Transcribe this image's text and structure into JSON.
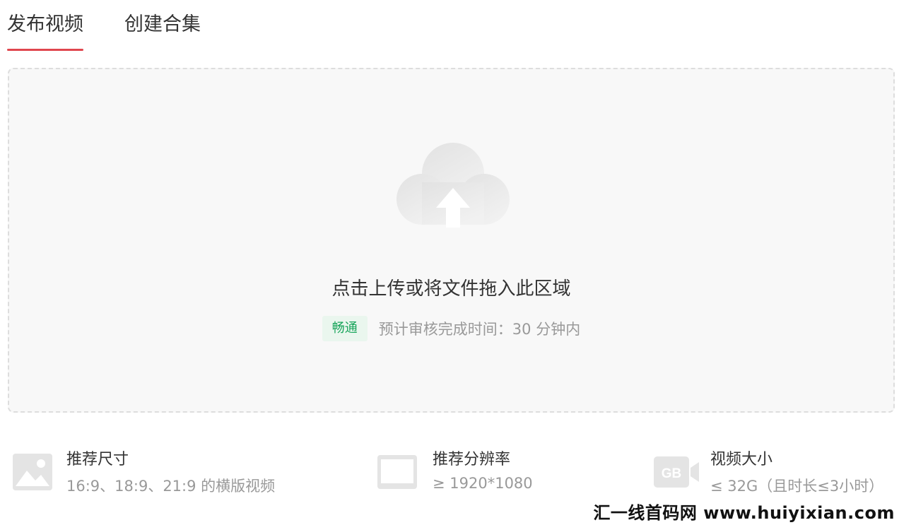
{
  "tabs": [
    {
      "label": "发布视频",
      "active": true
    },
    {
      "label": "创建合集",
      "active": false
    }
  ],
  "upload": {
    "icon": "cloud-upload-icon",
    "prompt": "点击上传或将文件拖入此区域",
    "status_badge": "畅通",
    "eta_text": "预计审核完成时间：30 分钟内"
  },
  "specs": [
    {
      "icon": "image-icon",
      "title": "推荐尺寸",
      "value": "16:9、18:9、21:9 的横版视频"
    },
    {
      "icon": "monitor-icon",
      "title": "推荐分辨率",
      "value": "≥ 1920*1080"
    },
    {
      "icon": "gb-camera-icon",
      "title": "视频大小",
      "value": "≤ 32G（且时长≤3小时）",
      "icon_text": "GB"
    }
  ],
  "watermark": "汇一线首码网 www.huiyixian.com",
  "colors": {
    "accent": "#e0464e",
    "badge_bg": "#eaf6ee",
    "badge_text": "#19a55b",
    "dropzone_bg": "#f8f8f8",
    "muted_text": "#999999"
  }
}
